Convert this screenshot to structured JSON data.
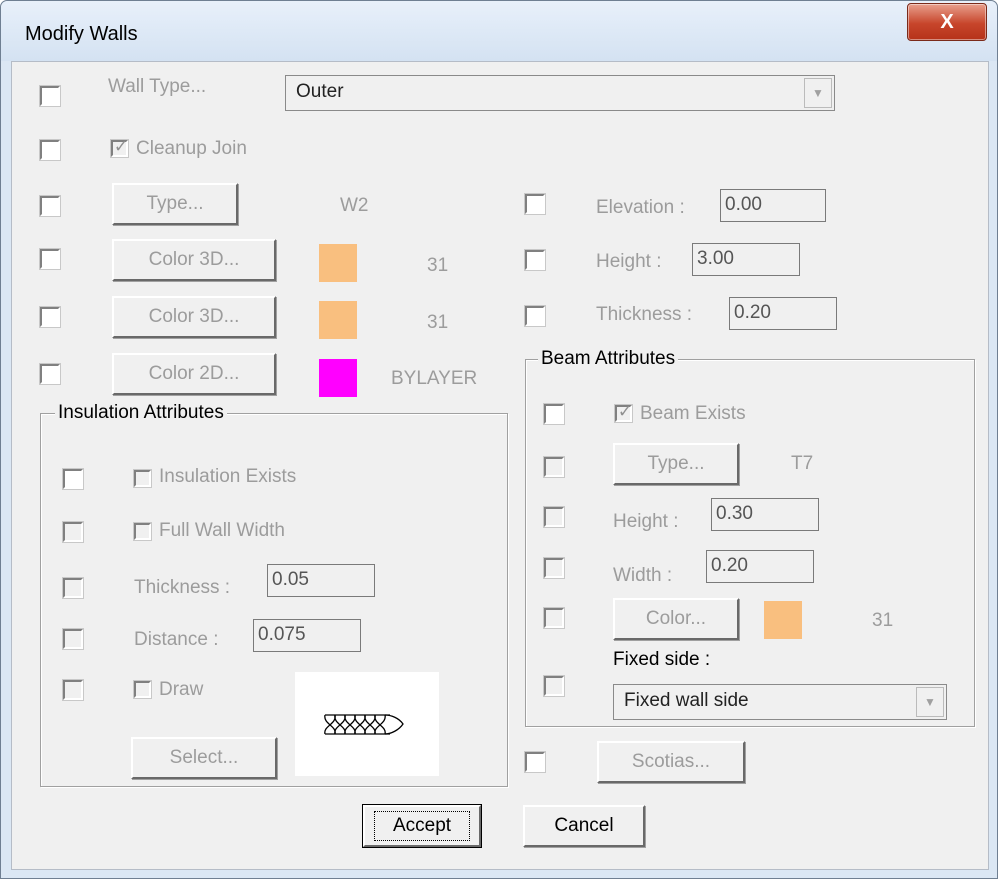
{
  "window": {
    "title": "Modify Walls",
    "close_glyph": "X"
  },
  "wall_type": {
    "label": "Wall Type...",
    "value": "Outer"
  },
  "cleanup_join": {
    "label": "Cleanup Join",
    "checked": true
  },
  "type": {
    "button": "Type...",
    "value": "W2"
  },
  "color3d_1": {
    "button": "Color 3D...",
    "color": "#f9bf7f",
    "value": "31"
  },
  "color3d_2": {
    "button": "Color 3D...",
    "color": "#f9bf7f",
    "value": "31"
  },
  "color2d": {
    "button": "Color 2D...",
    "color": "#ff00ff",
    "value": "BYLAYER"
  },
  "elevation": {
    "label": "Elevation :",
    "value": "0.00"
  },
  "height": {
    "label": "Height :",
    "value": "3.00"
  },
  "thickness": {
    "label": "Thickness :",
    "value": "0.20"
  },
  "insulation": {
    "title": "Insulation Attributes",
    "exists_label": "Insulation Exists",
    "full_width_label": "Full Wall Width",
    "thickness_label": "Thickness :",
    "thickness_value": "0.05",
    "distance_label": "Distance :",
    "distance_value": "0.075",
    "draw_label": "Draw",
    "select_button": "Select..."
  },
  "beam": {
    "title": "Beam Attributes",
    "exists_label": "Beam Exists",
    "type_button": "Type...",
    "type_value": "T7",
    "height_label": "Height :",
    "height_value": "0.30",
    "width_label": "Width :",
    "width_value": "0.20",
    "color_button": "Color...",
    "color": "#f9bf7f",
    "color_value": "31",
    "fixed_side_label": "Fixed side :",
    "fixed_side_value": "Fixed wall side"
  },
  "scotias_button": "Scotias...",
  "footer": {
    "accept": "Accept",
    "cancel": "Cancel"
  }
}
